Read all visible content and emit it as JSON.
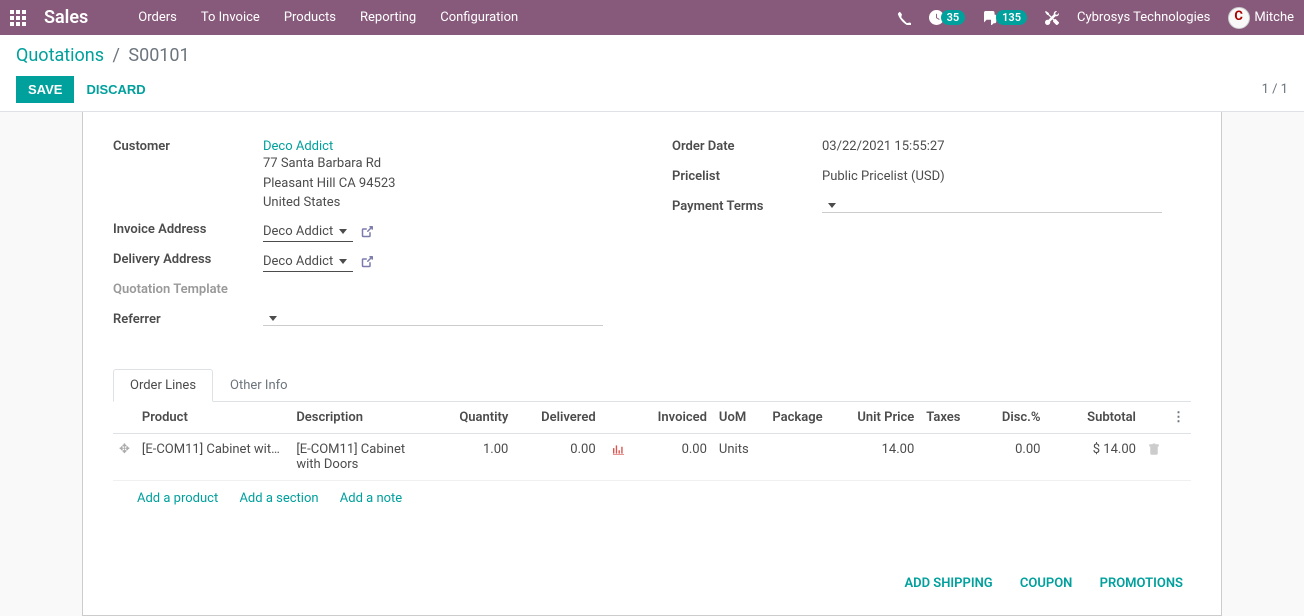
{
  "nav": {
    "brand": "Sales",
    "items": [
      "Orders",
      "To Invoice",
      "Products",
      "Reporting",
      "Configuration"
    ],
    "badge1": "35",
    "badge2": "135",
    "company": "Cybrosys Technologies",
    "user": "Mitche"
  },
  "breadcrumb": {
    "root": "Quotations",
    "current": "S00101"
  },
  "actions": {
    "save": "SAVE",
    "discard": "DISCARD"
  },
  "pager": "1 / 1",
  "form": {
    "customer_label": "Customer",
    "customer_name": "Deco Addict",
    "addr1": "77 Santa Barbara Rd",
    "addr2": "Pleasant Hill CA 94523",
    "addr3": "United States",
    "invoice_addr_label": "Invoice Address",
    "invoice_addr": "Deco Addict",
    "delivery_addr_label": "Delivery Address",
    "delivery_addr": "Deco Addict",
    "quotation_tpl_label": "Quotation Template",
    "referrer_label": "Referrer",
    "order_date_label": "Order Date",
    "order_date": "03/22/2021 15:55:27",
    "pricelist_label": "Pricelist",
    "pricelist": "Public Pricelist (USD)",
    "payment_terms_label": "Payment Terms"
  },
  "tabs": {
    "order_lines": "Order Lines",
    "other_info": "Other Info"
  },
  "table": {
    "headers": {
      "product": "Product",
      "description": "Description",
      "quantity": "Quantity",
      "delivered": "Delivered",
      "invoiced": "Invoiced",
      "uom": "UoM",
      "package": "Package",
      "unit_price": "Unit Price",
      "taxes": "Taxes",
      "disc": "Disc.%",
      "subtotal": "Subtotal"
    },
    "row": {
      "product": "[E-COM11] Cabinet with …",
      "description": "[E-COM11] Cabinet with Doors",
      "quantity": "1.00",
      "delivered": "0.00",
      "invoiced": "0.00",
      "uom": "Units",
      "unit_price": "14.00",
      "disc": "0.00",
      "subtotal": "$ 14.00"
    },
    "add_product": "Add a product",
    "add_section": "Add a section",
    "add_note": "Add a note"
  },
  "bottom": {
    "add_shipping": "ADD SHIPPING",
    "coupon": "COUPON",
    "promotions": "PROMOTIONS"
  }
}
